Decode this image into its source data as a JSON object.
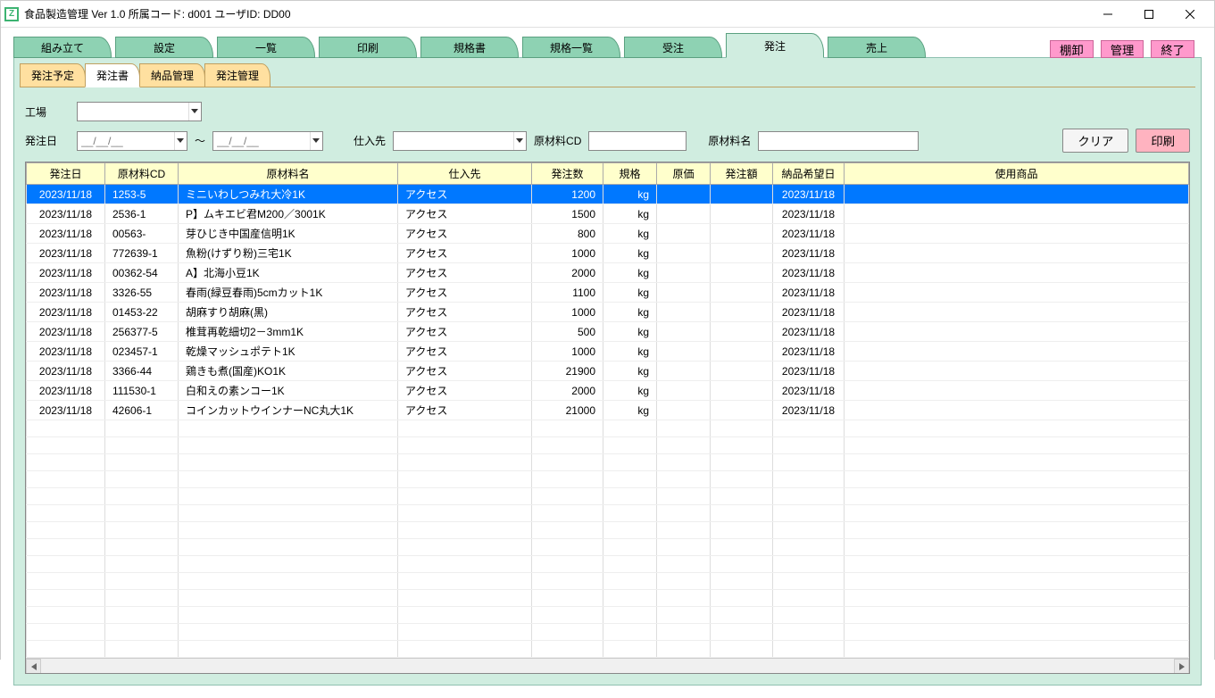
{
  "window": {
    "title": "食品製造管理 Ver 1.0  所属コード: d001     ユーザID: DD00"
  },
  "topTabs": [
    {
      "label": "組み立て"
    },
    {
      "label": "設定"
    },
    {
      "label": "一覧"
    },
    {
      "label": "印刷"
    },
    {
      "label": "規格書"
    },
    {
      "label": "規格一覧"
    },
    {
      "label": "受注"
    },
    {
      "label": "発注"
    },
    {
      "label": "売上"
    }
  ],
  "activeTopTab": 7,
  "pinkButtons": {
    "stock": "棚卸",
    "manage": "管理",
    "exit": "終了"
  },
  "subTabs": [
    {
      "label": "発注予定"
    },
    {
      "label": "発注書"
    },
    {
      "label": "納品管理"
    },
    {
      "label": "発注管理"
    }
  ],
  "activeSubTab": 1,
  "filters": {
    "factoryLabel": "工場",
    "orderDateLabel": "発注日",
    "datePlaceholder": "__/__/__",
    "tilde": "～",
    "supplierLabel": "仕入先",
    "materialCdLabel": "原材料CD",
    "materialNameLabel": "原材料名",
    "clearBtn": "クリア",
    "printBtn": "印刷"
  },
  "columns": {
    "date": "発注日",
    "cd": "原材料CD",
    "name": "原材料名",
    "supplier": "仕入先",
    "qty": "発注数",
    "spec": "規格",
    "price": "原価",
    "amount": "発注額",
    "delivery": "納品希望日",
    "product": "使用商品"
  },
  "rows": [
    {
      "date": "2023/11/18",
      "cd": "1253-5",
      "name": "ミニいわしつみれ大冷1K",
      "supplier": "アクセス",
      "qty": "1200",
      "spec": "kg",
      "price": "",
      "amount": "",
      "delivery": "2023/11/18",
      "product": ""
    },
    {
      "date": "2023/11/18",
      "cd": "2536-1",
      "name": "P】ムキエビ君M200／3001K",
      "supplier": "アクセス",
      "qty": "1500",
      "spec": "kg",
      "price": "",
      "amount": "",
      "delivery": "2023/11/18",
      "product": ""
    },
    {
      "date": "2023/11/18",
      "cd": "00563-",
      "name": "芽ひじき中国産信明1K",
      "supplier": "アクセス",
      "qty": "800",
      "spec": "kg",
      "price": "",
      "amount": "",
      "delivery": "2023/11/18",
      "product": ""
    },
    {
      "date": "2023/11/18",
      "cd": "772639-1",
      "name": "魚粉(けずり粉)三宅1K",
      "supplier": "アクセス",
      "qty": "1000",
      "spec": "kg",
      "price": "",
      "amount": "",
      "delivery": "2023/11/18",
      "product": ""
    },
    {
      "date": "2023/11/18",
      "cd": "00362-54",
      "name": "A】北海小豆1K",
      "supplier": "アクセス",
      "qty": "2000",
      "spec": "kg",
      "price": "",
      "amount": "",
      "delivery": "2023/11/18",
      "product": ""
    },
    {
      "date": "2023/11/18",
      "cd": "3326-55",
      "name": "春雨(緑豆春雨)5cmカット1K",
      "supplier": "アクセス",
      "qty": "1100",
      "spec": "kg",
      "price": "",
      "amount": "",
      "delivery": "2023/11/18",
      "product": ""
    },
    {
      "date": "2023/11/18",
      "cd": "01453-22",
      "name": "胡麻すり胡麻(黒)",
      "supplier": "アクセス",
      "qty": "1000",
      "spec": "kg",
      "price": "",
      "amount": "",
      "delivery": "2023/11/18",
      "product": ""
    },
    {
      "date": "2023/11/18",
      "cd": "256377-5",
      "name": "椎茸再乾細切2－3mm1K",
      "supplier": "アクセス",
      "qty": "500",
      "spec": "kg",
      "price": "",
      "amount": "",
      "delivery": "2023/11/18",
      "product": ""
    },
    {
      "date": "2023/11/18",
      "cd": "023457-1",
      "name": "乾燥マッシュポテト1K",
      "supplier": "アクセス",
      "qty": "1000",
      "spec": "kg",
      "price": "",
      "amount": "",
      "delivery": "2023/11/18",
      "product": ""
    },
    {
      "date": "2023/11/18",
      "cd": "3366-44",
      "name": "鶏きも煮(国産)KO1K",
      "supplier": "アクセス",
      "qty": "21900",
      "spec": "kg",
      "price": "",
      "amount": "",
      "delivery": "2023/11/18",
      "product": ""
    },
    {
      "date": "2023/11/18",
      "cd": "111530-1",
      "name": "白和えの素ンコー1K",
      "supplier": "アクセス",
      "qty": "2000",
      "spec": "kg",
      "price": "",
      "amount": "",
      "delivery": "2023/11/18",
      "product": ""
    },
    {
      "date": "2023/11/18",
      "cd": "42606-1",
      "name": "コインカットウインナーNC丸大1K",
      "supplier": "アクセス",
      "qty": "21000",
      "spec": "kg",
      "price": "",
      "amount": "",
      "delivery": "2023/11/18",
      "product": ""
    }
  ],
  "selectedRow": 0
}
